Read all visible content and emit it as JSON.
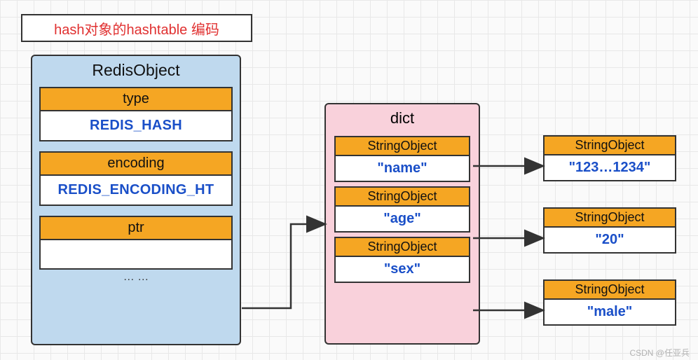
{
  "title": "hash对象的hashtable 编码",
  "redisObject": {
    "header": "RedisObject",
    "type_label": "type",
    "type_value": "REDIS_HASH",
    "encoding_label": "encoding",
    "encoding_value": "REDIS_ENCODING_HT",
    "ptr_label": "ptr",
    "ellipsis": "… …"
  },
  "dict": {
    "header": "dict",
    "keys": [
      {
        "header": "StringObject",
        "value": "\"name\""
      },
      {
        "header": "StringObject",
        "value": "\"age\""
      },
      {
        "header": "StringObject",
        "value": "\"sex\""
      }
    ]
  },
  "values": [
    {
      "header": "StringObject",
      "value": "\"123…1234\""
    },
    {
      "header": "StringObject",
      "value": "\"20\""
    },
    {
      "header": "StringObject",
      "value": "\"male\""
    }
  ],
  "watermark": "CSDN @任亚兵"
}
